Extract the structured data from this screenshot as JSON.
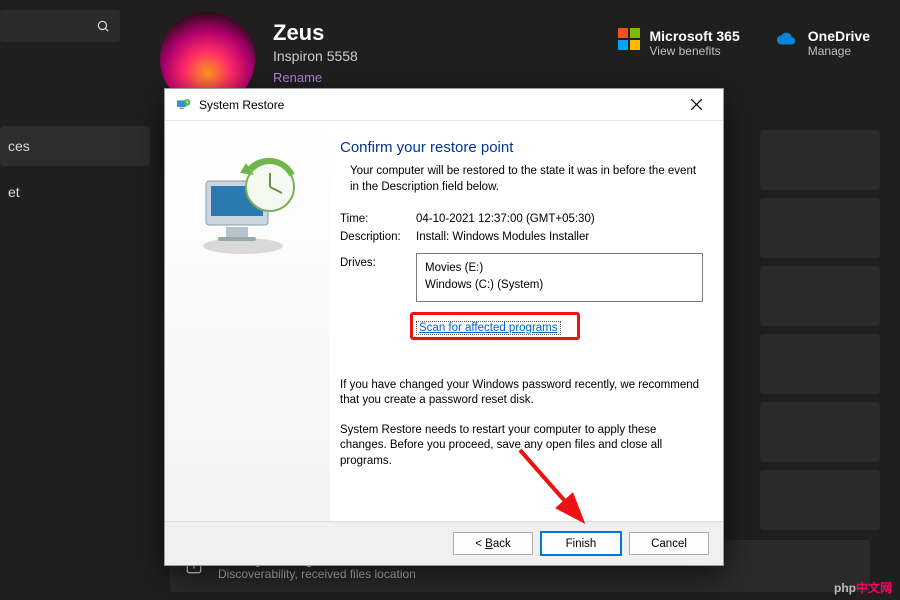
{
  "header": {
    "user_name": "Zeus",
    "device_model": "Inspiron 5558",
    "rename_label": "Rename"
  },
  "services": {
    "ms365": {
      "title": "Microsoft 365",
      "sub": "View benefits"
    },
    "onedrive": {
      "title": "OneDrive",
      "sub": "Manage"
    }
  },
  "left_nav": {
    "item_a": "ces",
    "item_b": "et"
  },
  "nearby": {
    "title": "Nearby sharing",
    "sub": "Discoverability, received files location"
  },
  "dialog": {
    "title": "System Restore",
    "heading": "Confirm your restore point",
    "intro": "Your computer will be restored to the state it was in before the event in the Description field below.",
    "time_label": "Time:",
    "time_value": "04-10-2021 12:37:00 (GMT+05:30)",
    "desc_label": "Description:",
    "desc_value": "Install: Windows Modules Installer",
    "drives_label": "Drives:",
    "drives": {
      "line1": "Movies (E:)",
      "line2": "Windows (C:) (System)"
    },
    "scan_link": "Scan for affected programs",
    "note1": "If you have changed your Windows password recently, we recommend that you create a password reset disk.",
    "note2": "System Restore needs to restart your computer to apply these changes. Before you proceed, save any open files and close all programs.",
    "buttons": {
      "back_prefix": "< ",
      "back_u": "B",
      "back_rest": "ack",
      "finish": "Finish",
      "cancel": "Cancel"
    }
  },
  "watermark": {
    "a": "php",
    "b": "中文网"
  }
}
